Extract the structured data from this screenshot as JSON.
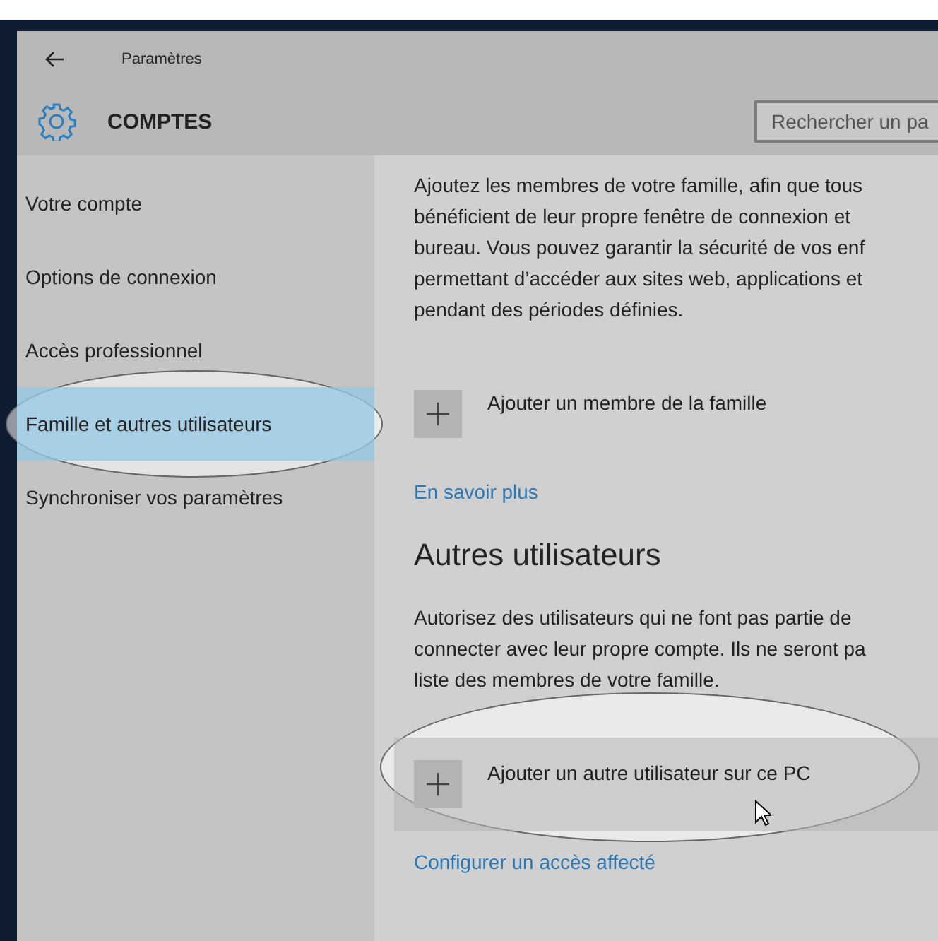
{
  "window": {
    "title": "Paramètres"
  },
  "header": {
    "title": "COMPTES",
    "search": {
      "placeholder": "Rechercher un pa"
    }
  },
  "sidebar": {
    "items": [
      {
        "label": "Votre compte",
        "selected": false,
        "circled": false
      },
      {
        "label": "Options de connexion",
        "selected": false,
        "circled": false
      },
      {
        "label": "Accès professionnel",
        "selected": false,
        "circled": false
      },
      {
        "label": "Famille et autres utilisateurs",
        "selected": true,
        "circled": true
      },
      {
        "label": "Synchroniser vos paramètres",
        "selected": false,
        "circled": false
      }
    ]
  },
  "sections": [
    {
      "lines": [
        "Ajoutez les membres de votre famille, afin que tous",
        "bénéficient de leur propre fenêtre de connexion et",
        "bureau. Vous pouvez garantir la sécurité de vos enf",
        "permettant d’accéder aux sites web, applications et",
        "pendant des périodes définies."
      ],
      "action": {
        "label": "Ajouter un membre de la famille",
        "hovered": false,
        "circled": false
      },
      "link": "En savoir plus"
    },
    {
      "heading": "Autres utilisateurs",
      "lines": [
        "Autorisez des utilisateurs qui ne font pas partie de",
        "connecter avec leur propre compte. Ils ne seront pa",
        "liste des membres de votre famille."
      ],
      "action": {
        "label": "Ajouter un autre utilisateur sur ce PC",
        "hovered": true,
        "circled": true
      },
      "link": "Configurer un accès affecté"
    }
  ]
}
